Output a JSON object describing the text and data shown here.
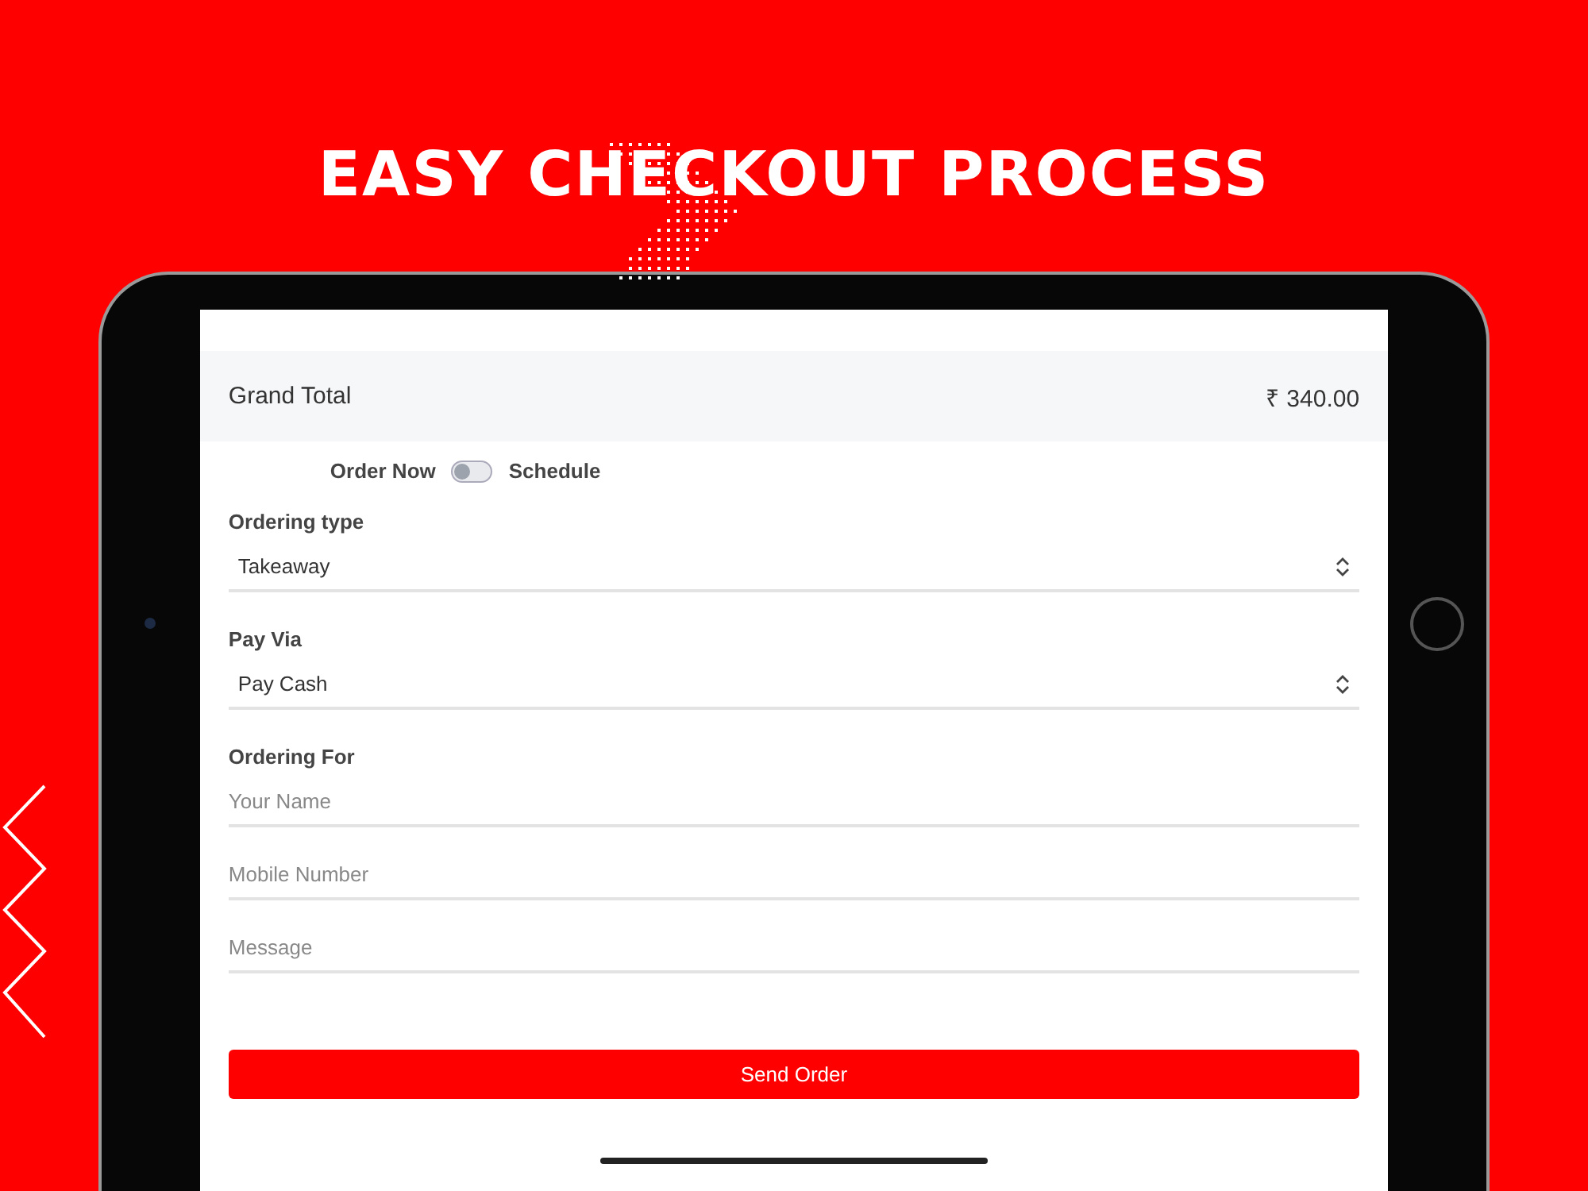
{
  "headline": "EASY CHECKOUT PROCESS",
  "grand_total": {
    "label": "Grand Total",
    "value": "₹ 340.00"
  },
  "order_toggle": {
    "left_label": "Order Now",
    "right_label": "Schedule",
    "on": false
  },
  "sections": [
    {
      "label": "Ordering type",
      "fields": [
        {
          "kind": "select",
          "value": "Takeaway"
        }
      ]
    },
    {
      "label": "Pay Via",
      "fields": [
        {
          "kind": "select",
          "value": "Pay Cash"
        }
      ]
    },
    {
      "label": "Ordering For",
      "fields": [
        {
          "kind": "text",
          "placeholder": "Your Name"
        },
        {
          "kind": "text",
          "placeholder": "Mobile Number"
        },
        {
          "kind": "text",
          "placeholder": "Message"
        }
      ]
    }
  ],
  "submit": {
    "label": "Send Order"
  }
}
